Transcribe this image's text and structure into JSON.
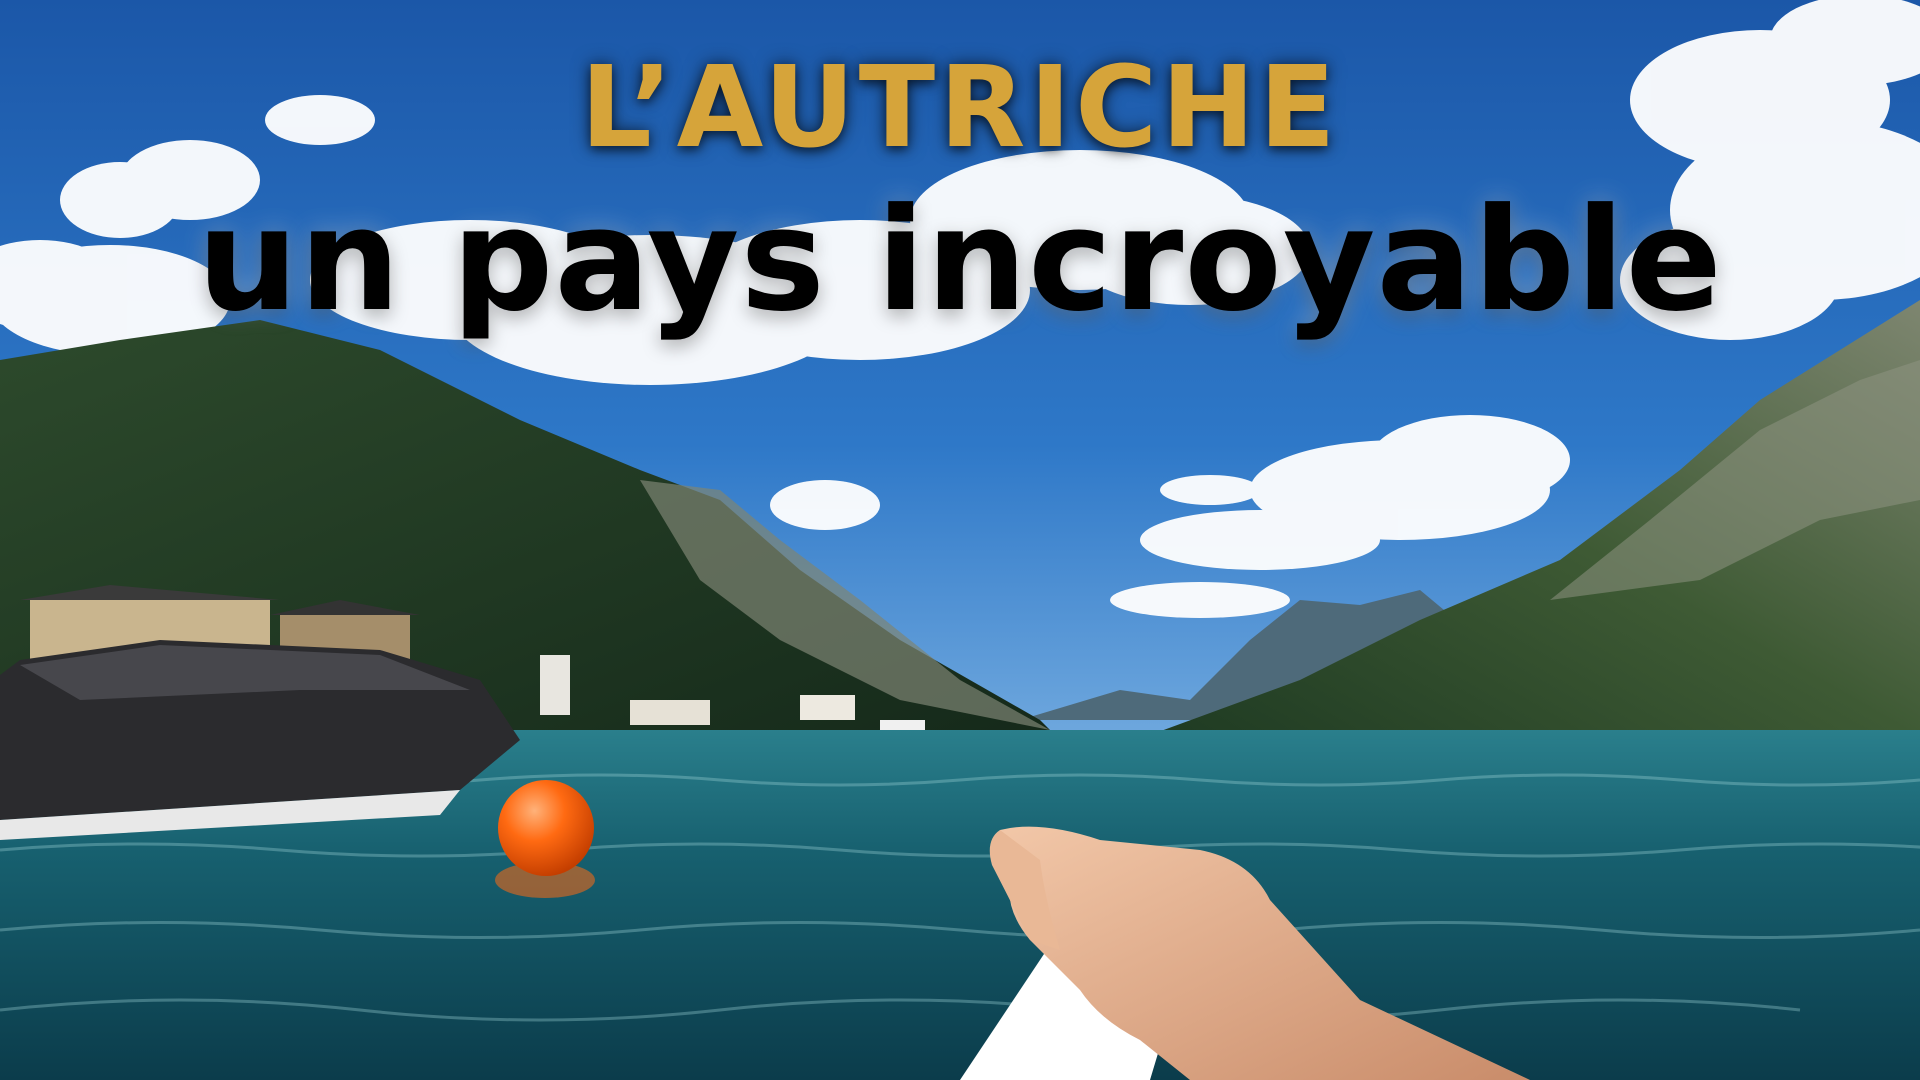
{
  "title": {
    "line1": "L’AUTRICHE",
    "line2": "un pays incroyable"
  },
  "colors": {
    "line1": "#D6A43A",
    "line2": "#000000",
    "sky_top": "#1C5FB0",
    "sky_bottom": "#5C9BD9",
    "water_top": "#1C6F7A",
    "water_bottom": "#0C3F4F",
    "buoy": "#FF6A12"
  }
}
